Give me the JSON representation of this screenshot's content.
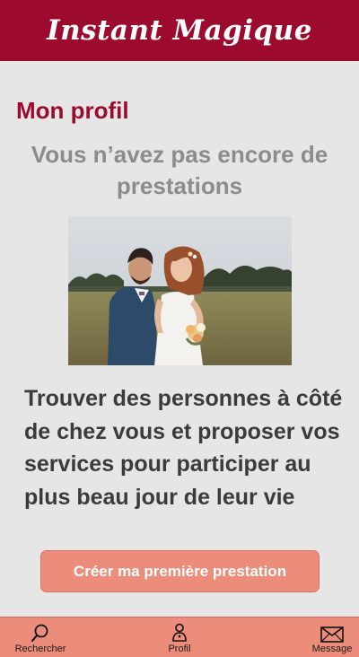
{
  "header": {
    "brand": "Instant Magique"
  },
  "main": {
    "title": "Mon profil",
    "empty_message": "Vous n’avez pas encore de prestations",
    "tagline": "Trouver des personnes à côté de chez vous et proposer vos services pour participer au plus beau jour de leur vie",
    "cta_label": "Créer ma première prestation"
  },
  "nav": {
    "items": [
      {
        "label": "Rechercher",
        "icon": "search-icon"
      },
      {
        "label": "Profil",
        "icon": "user-icon"
      },
      {
        "label": "Message",
        "icon": "envelope-icon"
      }
    ]
  },
  "colors": {
    "brand": "#9c0b2e",
    "accent": "#ec8c7a",
    "background": "#e6e6e6",
    "muted_text": "#8c8c8c",
    "dark_text": "#3b3b3b"
  }
}
